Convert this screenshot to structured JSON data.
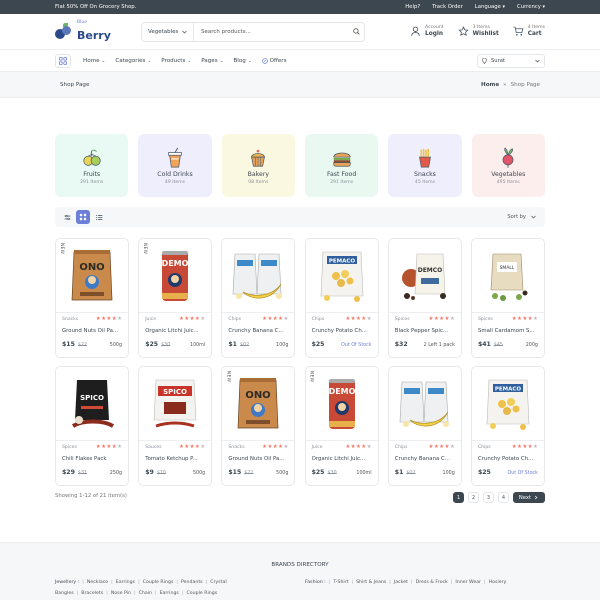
{
  "topbar": {
    "promo": "Flat 50% Off On Grocery Shop.",
    "links": [
      "Help?",
      "Track Order",
      "Language",
      "Currency"
    ]
  },
  "header": {
    "logo_small": "Blue",
    "logo_big": "Berry",
    "category_select": "Vegetables",
    "search_placeholder": "Search products...",
    "account_small": "Account",
    "account_big": "Login",
    "wishlist_small": "3 Items",
    "wishlist_big": "Wishlist",
    "cart_small": "4 Items",
    "cart_big": "Cart"
  },
  "nav": {
    "items": [
      "Home",
      "Categories",
      "Products",
      "Pages",
      "Blog",
      "Offers"
    ],
    "location": "Surat"
  },
  "breadcrumb": {
    "title": "Shop Page",
    "home": "Home",
    "sep": "»",
    "current": "Shop Page"
  },
  "categories": [
    {
      "name": "Fruits",
      "count": "291 Items",
      "bg": "#e8faf3",
      "icon": "fruits-icon"
    },
    {
      "name": "Cold Drinks",
      "count": "49 Items",
      "bg": "#efeefd",
      "icon": "cold-drink-icon"
    },
    {
      "name": "Bakery",
      "count": "08 Items",
      "bg": "#fbf8e2",
      "icon": "cupcake-icon"
    },
    {
      "name": "Fast Food",
      "count": "291 Items",
      "bg": "#e9f9f1",
      "icon": "burger-icon"
    },
    {
      "name": "Snacks",
      "count": "45 Items",
      "bg": "#efeefd",
      "icon": "fries-icon"
    },
    {
      "name": "Vegetables",
      "count": "495 Items",
      "bg": "#fdeeee",
      "icon": "radish-icon"
    }
  ],
  "toolbar": {
    "sort_label": "Sort by"
  },
  "products": [
    {
      "cat": "Snacks",
      "name": "Ground Nuts Oil Pa...",
      "price": "$15",
      "old": "$22",
      "unit": "500g",
      "unit_out": false,
      "new": "NEW",
      "img": "ono"
    },
    {
      "cat": "Juice",
      "name": "Organic Litchi Juic...",
      "price": "$25",
      "old": "$30",
      "unit": "100ml",
      "unit_out": false,
      "new": "NEW",
      "img": "can"
    },
    {
      "cat": "Chips",
      "name": "Crunchy Banana C...",
      "price": "$1",
      "old": "$02",
      "unit": "100g",
      "unit_out": false,
      "new": "",
      "img": "banana"
    },
    {
      "cat": "Chips",
      "name": "Crunchy Potato Ch...",
      "price": "$25",
      "old": "",
      "unit": "Out Of Stock",
      "unit_out": true,
      "new": "",
      "img": "pemaco"
    },
    {
      "cat": "Spices",
      "name": "Black Pepper Spic...",
      "price": "$32",
      "old": "",
      "unit": "2 Left    1 pack",
      "unit_out": false,
      "new": "",
      "img": "demco"
    },
    {
      "cat": "Spices",
      "name": "Small Cardamom S...",
      "price": "$41",
      "old": "$45",
      "unit": "200g",
      "unit_out": false,
      "new": "",
      "img": "cardamom"
    },
    {
      "cat": "Spices",
      "name": "Chili Flakes Pack",
      "price": "$29",
      "old": "$31",
      "unit": "250g",
      "unit_out": false,
      "new": "",
      "img": "spicyblack"
    },
    {
      "cat": "Sauces",
      "name": "Tomato Ketchup P...",
      "price": "$9",
      "old": "$10",
      "unit": "500g",
      "unit_out": false,
      "new": "",
      "img": "spico"
    },
    {
      "cat": "Snacks",
      "name": "Ground Nuts Oil Pa...",
      "price": "$15",
      "old": "$22",
      "unit": "500g",
      "unit_out": false,
      "new": "NEW",
      "img": "ono"
    },
    {
      "cat": "Juice",
      "name": "Organic Litchi Juic...",
      "price": "$25",
      "old": "$30",
      "unit": "100ml",
      "unit_out": false,
      "new": "NEW",
      "img": "can"
    },
    {
      "cat": "Chips",
      "name": "Crunchy Banana C...",
      "price": "$1",
      "old": "$02",
      "unit": "100g",
      "unit_out": false,
      "new": "",
      "img": "banana"
    },
    {
      "cat": "Chips",
      "name": "Crunchy Potato Ch...",
      "price": "$25",
      "old": "",
      "unit": "Out Of Stock",
      "unit_out": true,
      "new": "",
      "img": "pemaco"
    }
  ],
  "rating": 4,
  "pagination": {
    "showing": "Showing 1-12 of 21 item(s)",
    "pages": [
      "1",
      "2",
      "3",
      "4"
    ],
    "next": "Next"
  },
  "footer": {
    "title": "BRANDS DIRECTORY",
    "jewellery_label": "Jewellery :",
    "jewellery": [
      "Necklace",
      "Earrings",
      "Couple Rings",
      "Pendants",
      "Crystal"
    ],
    "jewellery2": [
      "Bangles",
      "Bracelets",
      "Nose Pin",
      "Chain",
      "Earrings",
      "Couple Rings"
    ],
    "fashion_label": "Fashion :",
    "fashion": [
      "T-Shirt",
      "Shirt & Jeans",
      "Jacket",
      "Dress & Frock",
      "Inner Wear",
      "Hosiery"
    ]
  }
}
